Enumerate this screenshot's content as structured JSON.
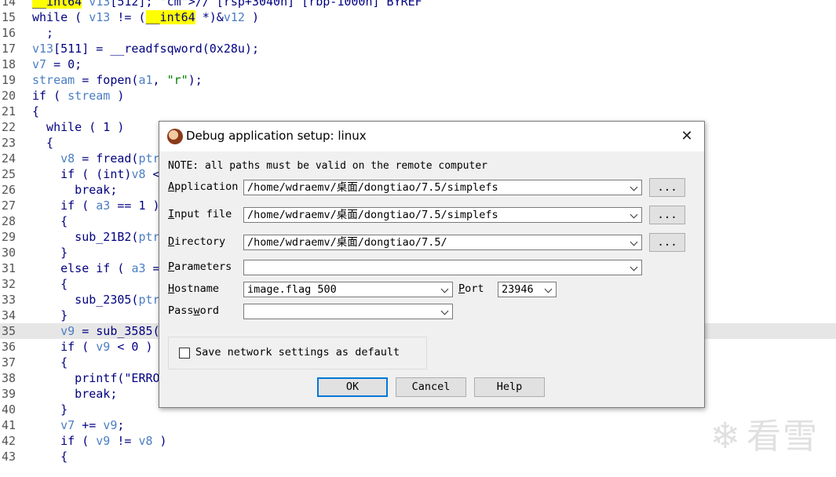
{
  "code": {
    "lines": [
      {
        "num": "14",
        "text": "__int64 v13[512]; // [rsp+3040h] [rbp-1000h] BYREF"
      },
      {
        "num": "15",
        "text": "while ( v13 != (__int64 *)&v12 )"
      },
      {
        "num": "16",
        "text": "  ;"
      },
      {
        "num": "17",
        "text": "v13[511] = __readfsqword(0x28u);"
      },
      {
        "num": "18",
        "text": "v7 = 0;"
      },
      {
        "num": "19",
        "text": "stream = fopen(a1, \"r\");"
      },
      {
        "num": "20",
        "text": "if ( stream )"
      },
      {
        "num": "21",
        "text": "{"
      },
      {
        "num": "22",
        "text": "  while ( 1 )"
      },
      {
        "num": "23",
        "text": "  {"
      },
      {
        "num": "24",
        "text": "    v8 = fread(ptr"
      },
      {
        "num": "25",
        "text": "    if ( (int)v8 <"
      },
      {
        "num": "26",
        "text": "      break;"
      },
      {
        "num": "27",
        "text": "    if ( a3 == 1 )"
      },
      {
        "num": "28",
        "text": "    {"
      },
      {
        "num": "29",
        "text": "      sub_21B2(ptr"
      },
      {
        "num": "30",
        "text": "    }"
      },
      {
        "num": "31",
        "text": "    else if ( a3 ="
      },
      {
        "num": "32",
        "text": "    {"
      },
      {
        "num": "33",
        "text": "      sub_2305(ptr"
      },
      {
        "num": "34",
        "text": "    }"
      },
      {
        "num": "35",
        "text": "    v9 = sub_3585("
      },
      {
        "num": "36",
        "text": "    if ( v9 < 0 )"
      },
      {
        "num": "37",
        "text": "    {"
      },
      {
        "num": "38",
        "text": "      printf(\"ERRO"
      },
      {
        "num": "39",
        "text": "      break;"
      },
      {
        "num": "40",
        "text": "    }"
      },
      {
        "num": "41",
        "text": "    v7 += v9;"
      },
      {
        "num": "42",
        "text": "    if ( v9 != v8 )"
      },
      {
        "num": "43",
        "text": "    {"
      }
    ],
    "highlighted_line": "35",
    "highlight_token": "__int64"
  },
  "watermark": {
    "text": "看雪",
    "icon": "snowflake-icon"
  },
  "dialog": {
    "title": "Debug application setup: linux",
    "close_icon": "close-icon",
    "note": "NOTE: all paths must be valid on the remote computer",
    "application": {
      "label_u": "A",
      "label_rest": "pplication",
      "value": "/home/wdraemv/桌面/dongtiao/7.5/simplefs"
    },
    "input_file": {
      "label_u": "I",
      "label_rest": "nput file",
      "value": "/home/wdraemv/桌面/dongtiao/7.5/simplefs"
    },
    "directory": {
      "label_u": "D",
      "label_rest": "irectory",
      "value": "/home/wdraemv/桌面/dongtiao/7.5/"
    },
    "parameters": {
      "label_u": "P",
      "label_rest": "arameters",
      "value": ""
    },
    "hostname": {
      "label_u": "H",
      "label_rest": "ostname",
      "value": "image.flag 500"
    },
    "port": {
      "label_u": "P",
      "label_rest": "ort",
      "value": "23946"
    },
    "password": {
      "label_pre": "Pass",
      "label_u": "w",
      "label_rest": "ord",
      "value": ""
    },
    "browse_label": "...",
    "save_checkbox": {
      "label": "Save network settings as default",
      "checked": false
    },
    "buttons": {
      "ok": "OK",
      "cancel": "Cancel",
      "help": "Help"
    }
  },
  "colors": {
    "highlight_yellow": "#ffff00",
    "default_button_border": "#0078d7",
    "dialog_bg": "#f0f0f0"
  }
}
